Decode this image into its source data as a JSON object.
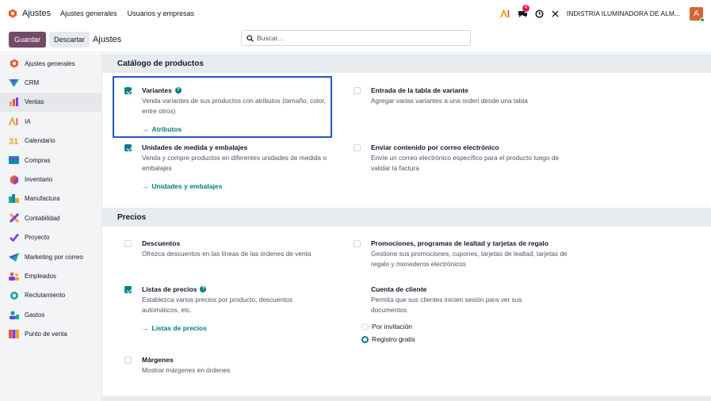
{
  "topbar": {
    "app_name": "Ajustes",
    "menu": [
      "Ajustes generales",
      "Usuarios y empresas"
    ],
    "messages_badge": "4",
    "company": "INDISTRIA ILUMINADORA DE ALM...",
    "avatar_letter": "A"
  },
  "control": {
    "save_label": "Guardar",
    "discard_label": "Descartar",
    "breadcrumb": "Ajustes",
    "search_placeholder": "Buscar..."
  },
  "sidebar": {
    "items": [
      {
        "label": "Ajustes generales",
        "icon": "odoo-settings-icon",
        "color": "#e85d25"
      },
      {
        "label": "CRM",
        "icon": "crm-icon",
        "color": "#1aa8a0"
      },
      {
        "label": "Ventas",
        "icon": "sales-icon",
        "color": "#e0584b"
      },
      {
        "label": "IA",
        "icon": "ai-icon",
        "color": "#e8a317"
      },
      {
        "label": "Calendario",
        "icon": "calendar-icon",
        "color": "#f0a22e"
      },
      {
        "label": "Compras",
        "icon": "purchase-icon",
        "color": "#0b8fa6"
      },
      {
        "label": "Inventario",
        "icon": "inventory-icon",
        "color": "#e0584b"
      },
      {
        "label": "Manufactura",
        "icon": "manufacturing-icon",
        "color": "#1aa8a0"
      },
      {
        "label": "Contabilidad",
        "icon": "accounting-icon",
        "color": "#f0a22e"
      },
      {
        "label": "Proyecto",
        "icon": "project-icon",
        "color": "#7c3aed"
      },
      {
        "label": "Marketing por correo",
        "icon": "email-marketing-icon",
        "color": "#3b5bdb"
      },
      {
        "label": "Empleados",
        "icon": "employees-icon",
        "color": "#e0584b"
      },
      {
        "label": "Reclutamiento",
        "icon": "recruitment-icon",
        "color": "#1aa8a0"
      },
      {
        "label": "Gastos",
        "icon": "expenses-icon",
        "color": "#0b8fa6"
      },
      {
        "label": "Punto de venta",
        "icon": "pos-icon",
        "color": "#e85d25"
      }
    ],
    "active_index": 2
  },
  "sections": [
    {
      "title": "Catálogo de productos"
    },
    {
      "title": "Precios"
    }
  ],
  "settings": {
    "variantes": {
      "title": "Variantes",
      "desc": "Venda variantes de sus productos con atributos (tamaño, color, entre otros)",
      "link": "Atributos",
      "checked": true
    },
    "entrada": {
      "title": "Entrada de la tabla de variante",
      "desc": "Agregar varias variantes a una orden desde una tabla",
      "checked": false
    },
    "unidades": {
      "title": "Unidades de medida y embalajes",
      "desc": "Venda y compre productos en diferentes unidades de medida o embalajes",
      "link": "Unidades y embalajes",
      "checked": true
    },
    "enviar": {
      "title": "Enviar contenido por correo electrónico",
      "desc": "Envíe un correo electrónico específico para el producto luego de validar la factura",
      "checked": false
    },
    "descuentos": {
      "title": "Descuentos",
      "desc": "Ofrezca descuentos en las líneas de las órdenes de venta",
      "checked": false
    },
    "promociones": {
      "title": "Promociones, programas de lealtad y tarjetas de regalo",
      "desc": "Gestione sus promociones, cupones, tarjetas de lealtad, tarjetas de regalo y monederos electrónicos",
      "checked": false
    },
    "listas": {
      "title": "Listas de precios",
      "desc": "Establezca varios precios por producto, descuentos automáticos, etc.",
      "link": "Listas de precios",
      "checked": true
    },
    "cuenta": {
      "title": "Cuenta de cliente",
      "desc": "Permita que sus clientes inicien sesión para ver sus documentos",
      "options": [
        "Por invitación",
        "Registro gratis"
      ],
      "selected": 1
    },
    "margenes": {
      "title": "Márgenes",
      "desc": "Mostrar márgenes en órdenes",
      "checked": false
    }
  }
}
